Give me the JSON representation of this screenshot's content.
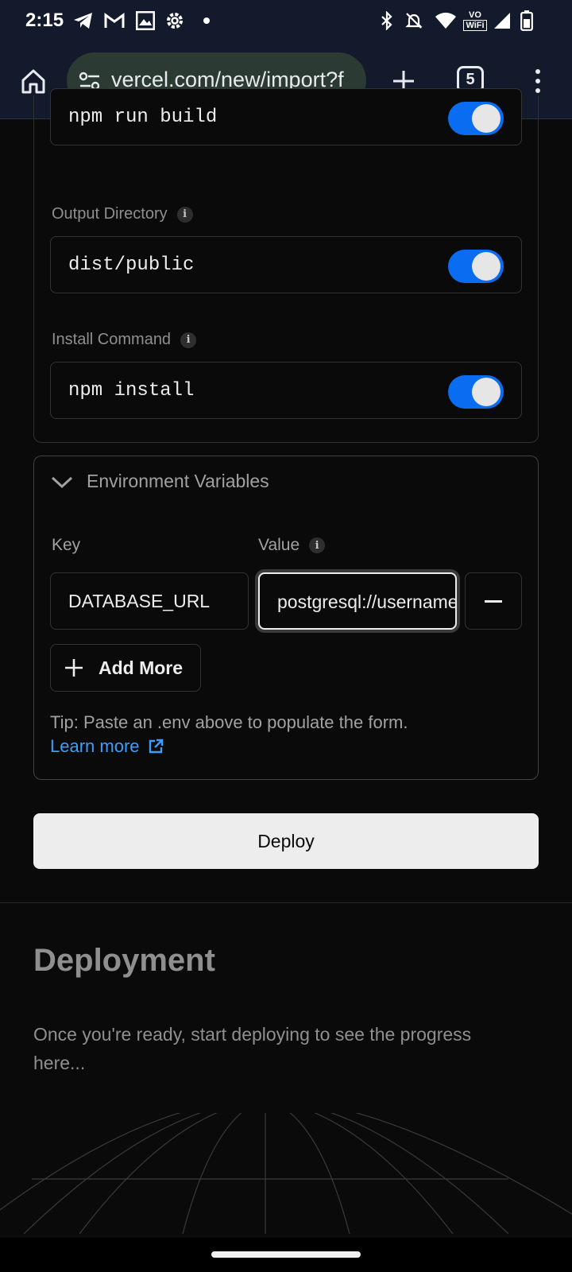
{
  "status_bar": {
    "time": "2:15",
    "left_icons": [
      "telegram-icon",
      "gmail-icon",
      "photo-icon",
      "settings-icon",
      "dot"
    ],
    "right_icons": [
      "bluetooth-icon",
      "mute-icon",
      "wifi-icon",
      "vowifi-icon",
      "signal-icon",
      "battery-icon"
    ],
    "vowifi_top": "VO",
    "vowifi_bottom": "WiFi"
  },
  "browser": {
    "url": "vercel.com/new/import?f",
    "tab_count": "5"
  },
  "build_settings": {
    "build_command": {
      "value": "npm run build",
      "override": true
    },
    "output_directory": {
      "label": "Output Directory",
      "value": "dist/public",
      "override": true
    },
    "install_command": {
      "label": "Install Command",
      "value": "npm install",
      "override": true
    }
  },
  "env": {
    "title": "Environment Variables",
    "key_label": "Key",
    "value_label": "Value",
    "key": "DATABASE_URL",
    "value": "postgresql://username",
    "add_more": "Add More",
    "tip": "Tip: Paste an .env above to populate the form.",
    "learn_more": "Learn more"
  },
  "deploy": {
    "button": "Deploy",
    "heading": "Deployment",
    "description": "Once you're ready, start deploying to see the progress here..."
  },
  "colors": {
    "accent": "#0a6cf0",
    "link": "#3b9eff",
    "background": "#0a0a0a"
  }
}
